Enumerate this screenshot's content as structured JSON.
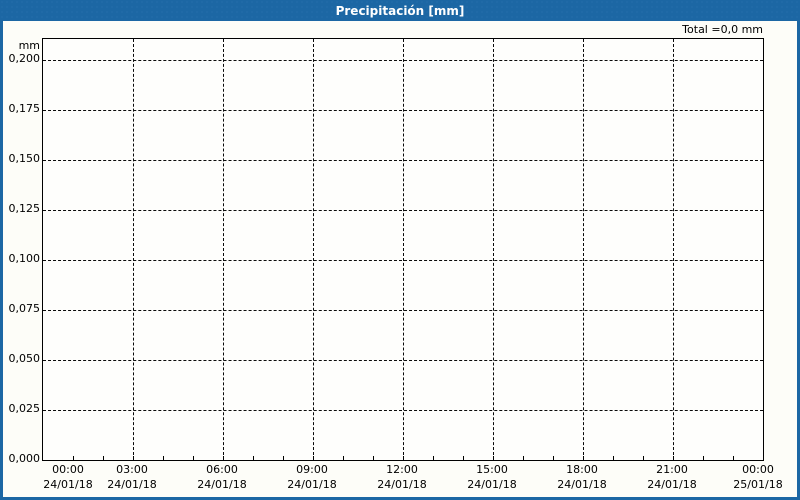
{
  "window": {
    "title": "Precipitación [mm]"
  },
  "summary": {
    "total_label": "Total =0,0 mm"
  },
  "colors": {
    "header_bg": "#1c67a4",
    "border": "#1c67a4",
    "background": "#fdfdf8",
    "grid": "#0a0a0a",
    "title_text": "#ffffff",
    "label_text": "#000000"
  },
  "chart_data": {
    "type": "line",
    "title": "Precipitación [mm]",
    "ylabel": "mm",
    "total": "0,0 mm",
    "ylim": [
      0,
      0.2105
    ],
    "y_tick_values": [
      0.2,
      0.175,
      0.15,
      0.125,
      0.1,
      0.075,
      0.05,
      0.025,
      0.0
    ],
    "y_tick_labels": [
      "0,200",
      "0,175",
      "0,150",
      "0,125",
      "0,100",
      "0,075",
      "0,050",
      "0,025",
      "0,000"
    ],
    "x_tick_hours": [
      0,
      3,
      6,
      9,
      12,
      15,
      18,
      21,
      24
    ],
    "x_tick_labels": [
      {
        "time": "00:00",
        "date": "24/01/18"
      },
      {
        "time": "03:00",
        "date": "24/01/18"
      },
      {
        "time": "06:00",
        "date": "24/01/18"
      },
      {
        "time": "09:00",
        "date": "24/01/18"
      },
      {
        "time": "12:00",
        "date": "24/01/18"
      },
      {
        "time": "15:00",
        "date": "24/01/18"
      },
      {
        "time": "18:00",
        "date": "24/01/18"
      },
      {
        "time": "21:00",
        "date": "24/01/18"
      },
      {
        "time": "00:00",
        "date": "25/01/18"
      }
    ],
    "minor_x_tick_hours": 1,
    "grid": "dashed",
    "legend": "none",
    "series": [
      {
        "name": "Precipitación",
        "values": []
      }
    ]
  }
}
